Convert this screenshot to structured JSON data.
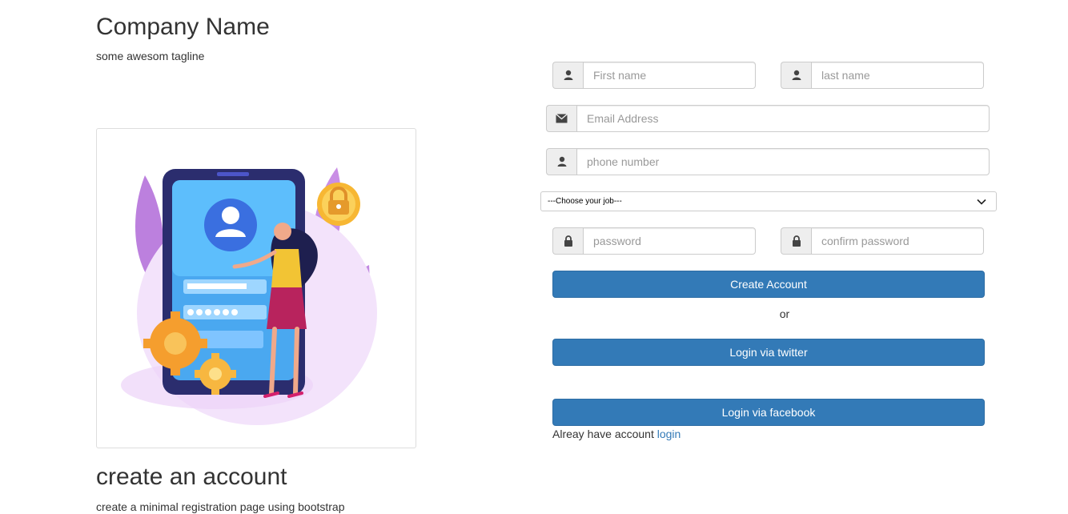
{
  "brand": {
    "title": "Company Name",
    "tagline": "some awesom tagline"
  },
  "cta": {
    "title": "create an account",
    "text": "create a minimal registration page using bootstrap"
  },
  "form": {
    "first_name": {
      "placeholder": "First name",
      "icon": "user-icon"
    },
    "last_name": {
      "placeholder": "last name",
      "icon": "user-icon"
    },
    "email": {
      "placeholder": "Email Address",
      "icon": "envelope-icon"
    },
    "phone": {
      "placeholder": "phone number",
      "icon": "user-icon"
    },
    "job": {
      "selected": "---Choose your job---",
      "icon": "chevron-down-icon"
    },
    "password": {
      "placeholder": "password",
      "icon": "lock-icon"
    },
    "confirm_password": {
      "placeholder": "confirm password",
      "icon": "lock-icon"
    }
  },
  "buttons": {
    "create_account": "Create Account",
    "or": "or",
    "twitter": "Login via twitter",
    "facebook": "Login via facebook"
  },
  "login_prompt": {
    "text": "Alreay have account",
    "link": "login"
  },
  "colors": {
    "primary": "#337ab7",
    "addon_bg": "#eeeeee",
    "border": "#cccccc",
    "text": "#333333"
  }
}
